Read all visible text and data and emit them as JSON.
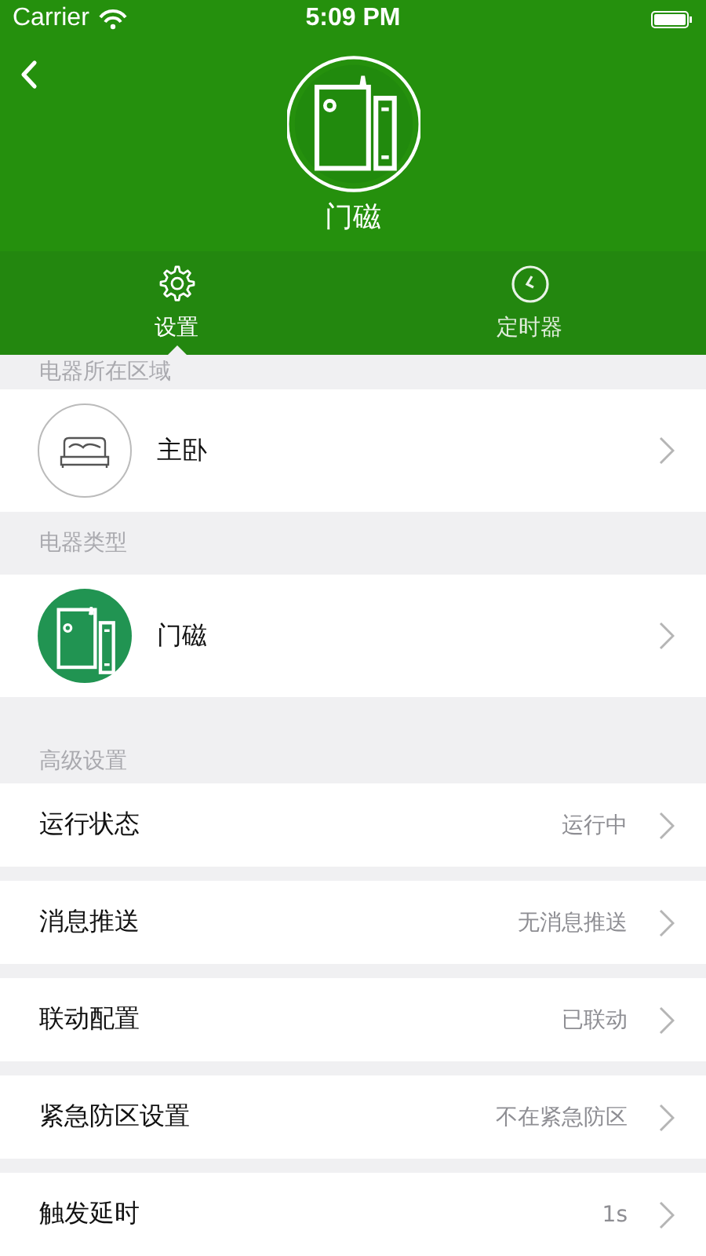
{
  "status_bar": {
    "carrier": "Carrier",
    "time": "5:09 PM"
  },
  "header": {
    "title": "门磁"
  },
  "tabs": [
    {
      "label": "设置",
      "kind": "gear",
      "selected": true
    },
    {
      "label": "定时器",
      "kind": "clock",
      "selected": false
    }
  ],
  "sections": [
    {
      "title": "电器所在区域",
      "items": [
        {
          "label": "主卧",
          "kind": "bed"
        }
      ]
    },
    {
      "title": "电器类型",
      "items": [
        {
          "label": "门磁",
          "kind": "sensor"
        }
      ]
    },
    {
      "title": "高级设置",
      "items": [
        {
          "label": "运行状态",
          "value": "运行中",
          "kind": "setting"
        },
        {
          "label": "消息推送",
          "value": "无消息推送",
          "kind": "setting"
        },
        {
          "label": "联动配置",
          "value": "已联动",
          "kind": "setting"
        },
        {
          "label": "紧急防区设置",
          "value": "不在紧急防区",
          "kind": "setting"
        },
        {
          "label": "触发延时",
          "value": "1s",
          "kind": "setting"
        }
      ]
    }
  ]
}
